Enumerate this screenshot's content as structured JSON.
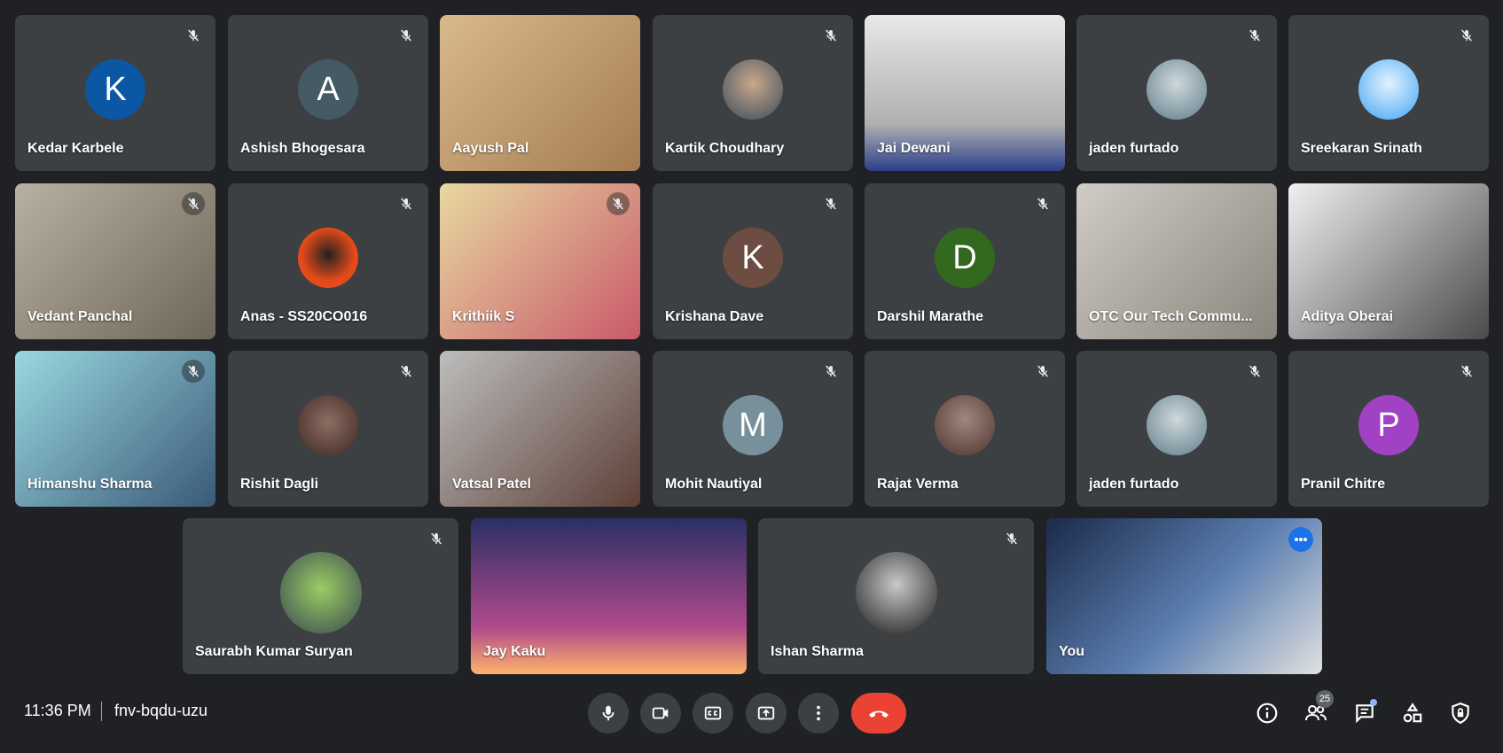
{
  "colors": {
    "background": "#202124",
    "tile": "#3c4043",
    "end_call": "#ea4335",
    "self_outline": "#8ab4f8"
  },
  "participants": [
    {
      "name": "Kedar Karbele",
      "type": "initial",
      "initial": "K",
      "avatar_color": "#0b57a4",
      "muted": true
    },
    {
      "name": "Ashish Bhogesara",
      "type": "initial",
      "initial": "A",
      "avatar_color": "#455a64",
      "muted": true
    },
    {
      "name": "Aayush Pal",
      "type": "video",
      "bg": "linear-gradient(135deg,#d9b98b,#a57c52)",
      "muted": false
    },
    {
      "name": "Kartik Choudhary",
      "type": "photo",
      "photo": "radial-gradient(circle at 50% 40%,#c9a98a,#3a4a5e)",
      "muted": true
    },
    {
      "name": "Jai Dewani",
      "type": "video",
      "bg": "linear-gradient(180deg,#e8e8e8,#b0b0b0 70%,#2b3f8c)",
      "muted": false
    },
    {
      "name": "jaden furtado",
      "type": "photo",
      "photo": "radial-gradient(circle at 50% 40%,#cfd8dc,#607d8b)",
      "muted": true
    },
    {
      "name": "Sreekaran Srinath",
      "type": "photo",
      "photo": "radial-gradient(circle at 50% 40%,#e3f2fd,#42a5f5)",
      "muted": true
    },
    {
      "name": "Vedant Panchal",
      "type": "video",
      "bg": "linear-gradient(135deg,#b8b0a0,#6e6658)",
      "muted": true
    },
    {
      "name": "Anas - SS20CO016",
      "type": "photo",
      "photo": "radial-gradient(circle at 50% 45%,#222,#e64a19 60%)",
      "muted": true
    },
    {
      "name": "Krithiik S",
      "type": "video",
      "bg": "linear-gradient(135deg,#e8d9a0,#c95a6a)",
      "muted": true
    },
    {
      "name": "Krishana Dave",
      "type": "initial",
      "initial": "K",
      "avatar_color": "#6d4c41",
      "muted": true
    },
    {
      "name": "Darshil Marathe",
      "type": "initial",
      "initial": "D",
      "avatar_color": "#33691e",
      "muted": true
    },
    {
      "name": "OTC Our Tech Commu...",
      "type": "video",
      "bg": "linear-gradient(135deg,#d0ccc6,#8a857c)",
      "muted": false
    },
    {
      "name": "Aditya Oberai",
      "type": "video",
      "bg": "linear-gradient(135deg,#f0f0f0,#4a4a4a)",
      "muted": false
    },
    {
      "name": "Himanshu Sharma",
      "type": "video",
      "bg": "linear-gradient(135deg,#9ad8e0,#3a5a78)",
      "muted": true
    },
    {
      "name": "Rishit Dagli",
      "type": "photo",
      "photo": "radial-gradient(circle at 50% 45%,#8d6e63,#3e2723)",
      "muted": true
    },
    {
      "name": "Vatsal Patel",
      "type": "video",
      "bg": "linear-gradient(135deg,#bdbdbd,#5d4037)",
      "muted": false
    },
    {
      "name": "Mohit Nautiyal",
      "type": "initial",
      "initial": "M",
      "avatar_color": "#78909c",
      "muted": true
    },
    {
      "name": "Rajat Verma",
      "type": "photo",
      "photo": "radial-gradient(circle at 50% 40%,#a1887f,#4e342e)",
      "muted": true
    },
    {
      "name": "jaden furtado",
      "type": "photo",
      "photo": "radial-gradient(circle at 50% 40%,#cfd8dc,#607d8b)",
      "muted": true
    },
    {
      "name": "Pranil Chitre",
      "type": "initial",
      "initial": "P",
      "avatar_color": "#a142c4",
      "muted": true
    },
    {
      "name": "Saurabh Kumar Suryan",
      "type": "photo",
      "photo": "radial-gradient(circle at 50% 45%,#9ccc65,#37474f)",
      "muted": true
    },
    {
      "name": "Jay Kaku",
      "type": "video",
      "bg": "linear-gradient(180deg,#2a2f66,#b04a8c 70%,#ffb36b)",
      "muted": false
    },
    {
      "name": "Ishan Sharma",
      "type": "photo",
      "photo": "radial-gradient(circle at 50% 40%,#c8c8c8,#1b1b1b)",
      "muted": true
    },
    {
      "name": "You",
      "type": "video",
      "bg": "linear-gradient(135deg,#1b2a4a,#5c7fb0 55%,#e0e0e0)",
      "muted": false,
      "self": true
    }
  ],
  "bottom_bar": {
    "time": "11:36 PM",
    "meeting_code": "fnv-bqdu-uzu",
    "controls": [
      "microphone-icon",
      "camera-icon",
      "captions-icon",
      "present-icon",
      "more-options-icon",
      "end-call-icon"
    ],
    "right_icons": [
      "info-icon",
      "people-icon",
      "chat-icon",
      "activities-icon",
      "host-controls-icon"
    ],
    "participant_count": "25"
  }
}
